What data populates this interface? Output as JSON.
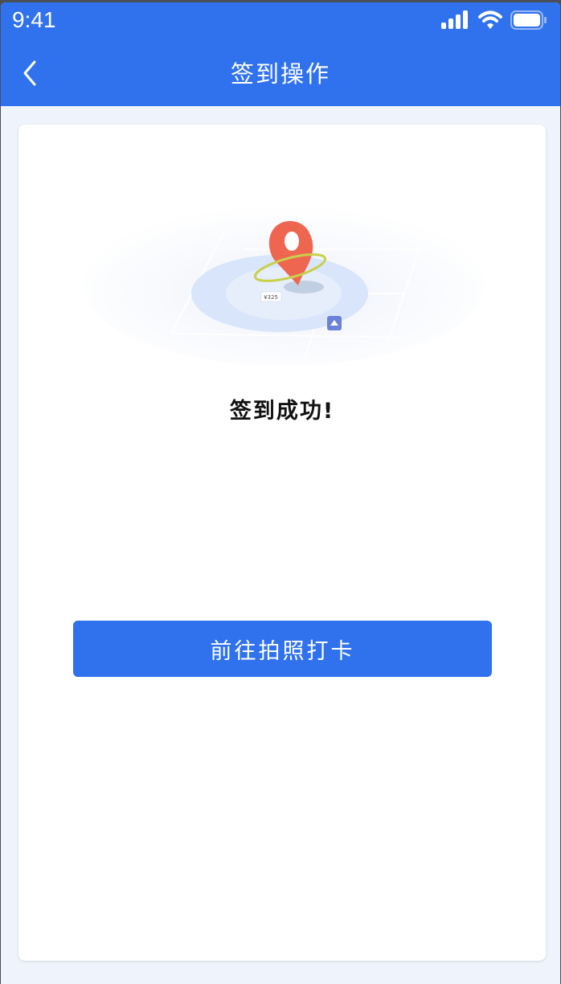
{
  "status_bar": {
    "time": "9:41",
    "icons": [
      "signal-icon",
      "wifi-icon",
      "battery-icon"
    ]
  },
  "header": {
    "title": "签到操作",
    "back_icon": "chevron-left-icon"
  },
  "main": {
    "illustration": "location-pin-map-illustration",
    "map_label": "¥325",
    "message": "签到成功!",
    "action_button": "前往拍照打卡"
  },
  "colors": {
    "primary": "#3072ee",
    "background": "#eef3fc",
    "pin": "#ef6650"
  }
}
